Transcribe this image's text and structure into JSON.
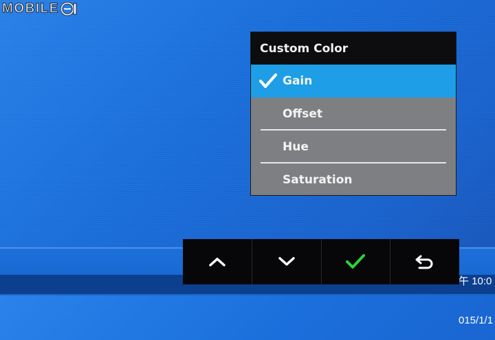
{
  "watermark": {
    "text": "MOBILE"
  },
  "menu": {
    "title": "Custom Color",
    "items": [
      {
        "label": "Gain",
        "selected": true
      },
      {
        "label": "Offset",
        "selected": false
      },
      {
        "label": "Hue",
        "selected": false
      },
      {
        "label": "Saturation",
        "selected": false
      }
    ]
  },
  "nav": {
    "buttons": [
      {
        "icon": "chevron-up-icon"
      },
      {
        "icon": "chevron-down-icon"
      },
      {
        "icon": "checkmark-icon"
      },
      {
        "icon": "return-icon"
      }
    ]
  },
  "clock": {
    "time": "午 10:0",
    "date": "015/1/1"
  },
  "colors": {
    "desktop": "#1b6fdc",
    "menu_bg": "#7d7f83",
    "menu_title_bg": "#0d0d0f",
    "selected_bg": "#1d9ee6",
    "confirm_green": "#2bd33a",
    "nav_bar_bg": "#070709"
  }
}
